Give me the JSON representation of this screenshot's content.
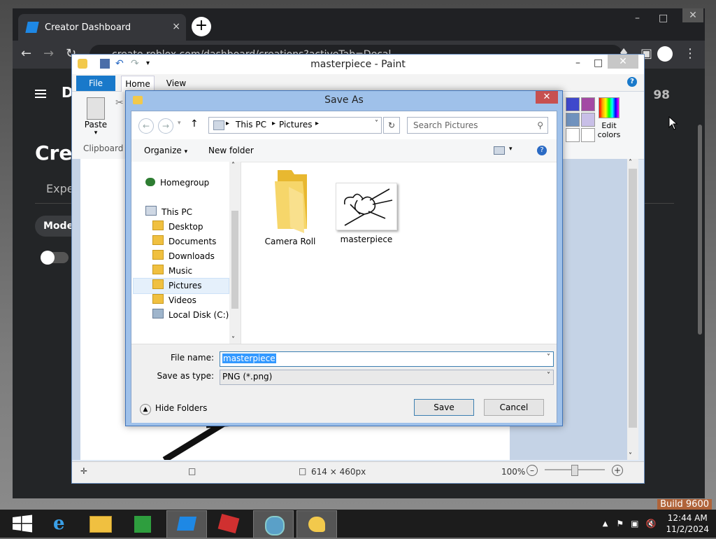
{
  "browser": {
    "tab_title": "Creator Dashboard",
    "tab_close": "×",
    "new_tab": "+",
    "url": "create.roblox.com/dashboard/creations?activeTab=Decal",
    "page": {
      "header_letter": "D",
      "heading": "Crea",
      "experiences_tab": "Expe",
      "models_chip": "Model",
      "user_number": "98"
    }
  },
  "paint": {
    "title": "masterpiece - Paint",
    "tabs": {
      "file": "File",
      "home": "Home",
      "view": "View"
    },
    "help": "?",
    "paste": "Paste",
    "clipboard": "Clipboard",
    "edit_colors_line1": "Edit",
    "edit_colors_line2": "colors",
    "image_size": "614 × 460px",
    "zoom": "100%",
    "palette": [
      "#3f48cc",
      "#a349a4",
      "#7092be",
      "#c8bfe7",
      "#ffffff",
      "#ffffff"
    ]
  },
  "dialog": {
    "title": "Save As",
    "breadcrumb": {
      "root": "This PC",
      "folder": "Pictures"
    },
    "search_placeholder": "Search Pictures",
    "toolbar": {
      "organize": "Organize",
      "new_folder": "New folder"
    },
    "nav": {
      "homegroup": "Homegroup",
      "this_pc": "This PC",
      "items": [
        "Desktop",
        "Documents",
        "Downloads",
        "Music",
        "Pictures",
        "Videos",
        "Local Disk (C:)"
      ]
    },
    "files": [
      {
        "name": "Camera Roll",
        "type": "folder"
      },
      {
        "name": "masterpiece",
        "type": "image"
      }
    ],
    "file_name_label": "File name:",
    "file_name_value": "masterpiece",
    "save_type_label": "Save as type:",
    "save_type_value": "PNG (*.png)",
    "hide_folders": "Hide Folders",
    "save": "Save",
    "cancel": "Cancel"
  },
  "taskbar": {
    "time": "12:44 AM",
    "date": "11/2/2024",
    "build": "Build 9600"
  }
}
